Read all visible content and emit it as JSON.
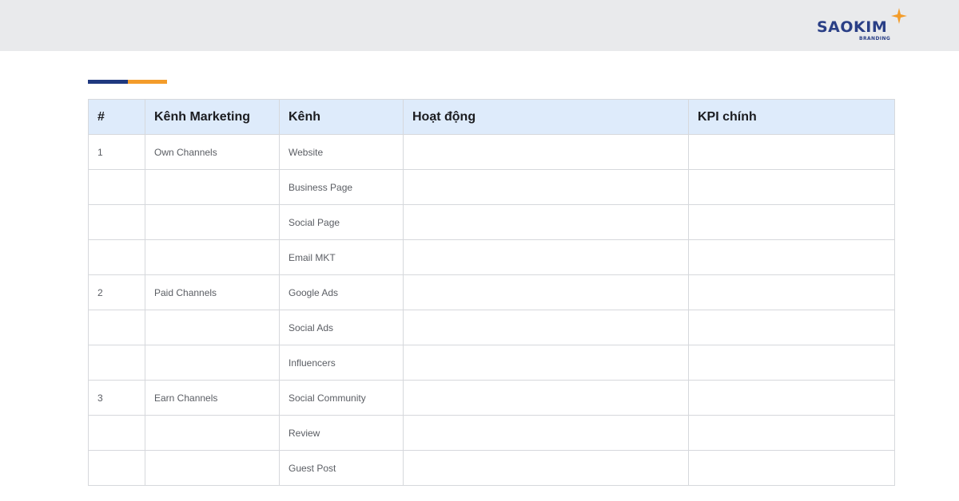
{
  "brand": {
    "name": "SAOKIM",
    "tagline": "BRANDING",
    "colors": {
      "navy": "#20397f",
      "orange": "#f39c2a",
      "header_bg": "#deebfb"
    }
  },
  "table": {
    "headers": [
      "#",
      "Kênh Marketing",
      "Kênh",
      "Hoạt động",
      "KPI chính"
    ],
    "rows": [
      [
        "1",
        "Own Channels",
        "Website",
        "",
        ""
      ],
      [
        "",
        "",
        "Business Page",
        "",
        ""
      ],
      [
        "",
        "",
        "Social Page",
        "",
        ""
      ],
      [
        "",
        "",
        "Email MKT",
        "",
        ""
      ],
      [
        "2",
        "Paid Channels",
        "Google Ads",
        "",
        ""
      ],
      [
        "",
        "",
        "Social Ads",
        "",
        ""
      ],
      [
        "",
        "",
        "Influencers",
        "",
        ""
      ],
      [
        "3",
        "Earn Channels",
        "Social Community",
        "",
        ""
      ],
      [
        "",
        "",
        "Review",
        "",
        ""
      ],
      [
        "",
        "",
        "Guest Post",
        "",
        ""
      ]
    ]
  }
}
